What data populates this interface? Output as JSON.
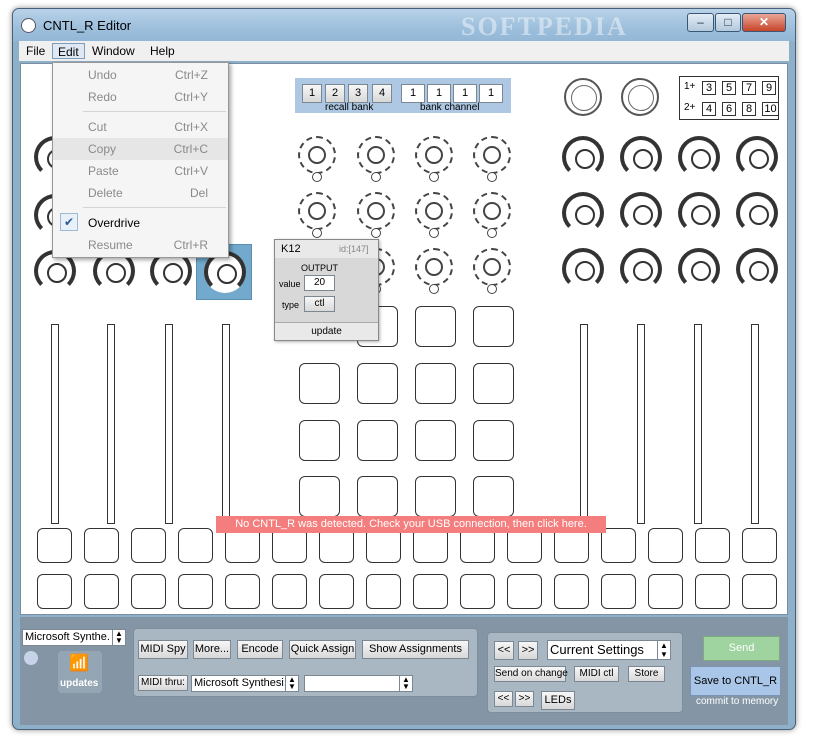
{
  "window": {
    "title": "CNTL_R Editor",
    "watermark": "SOFTPEDIA",
    "minimize": "–",
    "maximize": "□",
    "close": "✕"
  },
  "menubar": [
    "File",
    "Edit",
    "Window",
    "Help"
  ],
  "edit_menu": {
    "items": [
      {
        "label": "Undo",
        "shortcut": "Ctrl+Z"
      },
      {
        "label": "Redo",
        "shortcut": "Ctrl+Y"
      },
      {
        "label": "Cut",
        "shortcut": "Ctrl+X"
      },
      {
        "label": "Copy",
        "shortcut": "Ctrl+C"
      },
      {
        "label": "Paste",
        "shortcut": "Ctrl+V"
      },
      {
        "label": "Delete",
        "shortcut": "Del"
      },
      {
        "label": "Overdrive",
        "shortcut": ""
      },
      {
        "label": "Resume",
        "shortcut": "Ctrl+R"
      }
    ],
    "check": "✔"
  },
  "top_panel": {
    "recall_buttons": [
      "1",
      "2",
      "3",
      "4"
    ],
    "recall_label": "recall bank",
    "channel_buttons": [
      "1",
      "1",
      "1",
      "1"
    ],
    "channel_label": "bank channel"
  },
  "right_boxes": {
    "row1_label": "1+",
    "row1": [
      "3",
      "5",
      "7",
      "9"
    ],
    "row2_label": "2+",
    "row2": [
      "4",
      "6",
      "8",
      "10"
    ]
  },
  "inspector": {
    "name": "K12",
    "id": "id:[147]",
    "section": "OUTPUT",
    "value_label": "value",
    "value": "20",
    "type_label": "type",
    "type": "ctl",
    "update": "update"
  },
  "warning": "No CNTL_R was detected. Check your USB connection, then click here.",
  "bottom": {
    "midi_device": "Microsoft Synthe.",
    "updates_label": "updates",
    "buttons": [
      "MIDI Spy",
      "More...",
      "Encode",
      "Quick Assign",
      "Show Assignments"
    ],
    "midi_thru_label": "MIDI thru:",
    "midi_thru_device": "Microsoft Synthesi.",
    "midi_thru_device2": "",
    "nav_prev": "<<",
    "nav_next": ">>",
    "settings_select": "Current Settings",
    "send_on_change": "Send on change",
    "midi_ctl": "MIDI ctl",
    "store": "Store",
    "leds_prev": "<<",
    "leds_next": ">>",
    "leds": "LEDs",
    "send": "Send",
    "save": "Save to CNTL_R",
    "commit": "commit to memory"
  },
  "colors": {
    "window_frame": "#8fb0c9",
    "selected_knob": "#72a9cc",
    "warning_bg": "#f47d7d",
    "send_button": "#9fd39f",
    "save_button": "#a9c6e8"
  }
}
